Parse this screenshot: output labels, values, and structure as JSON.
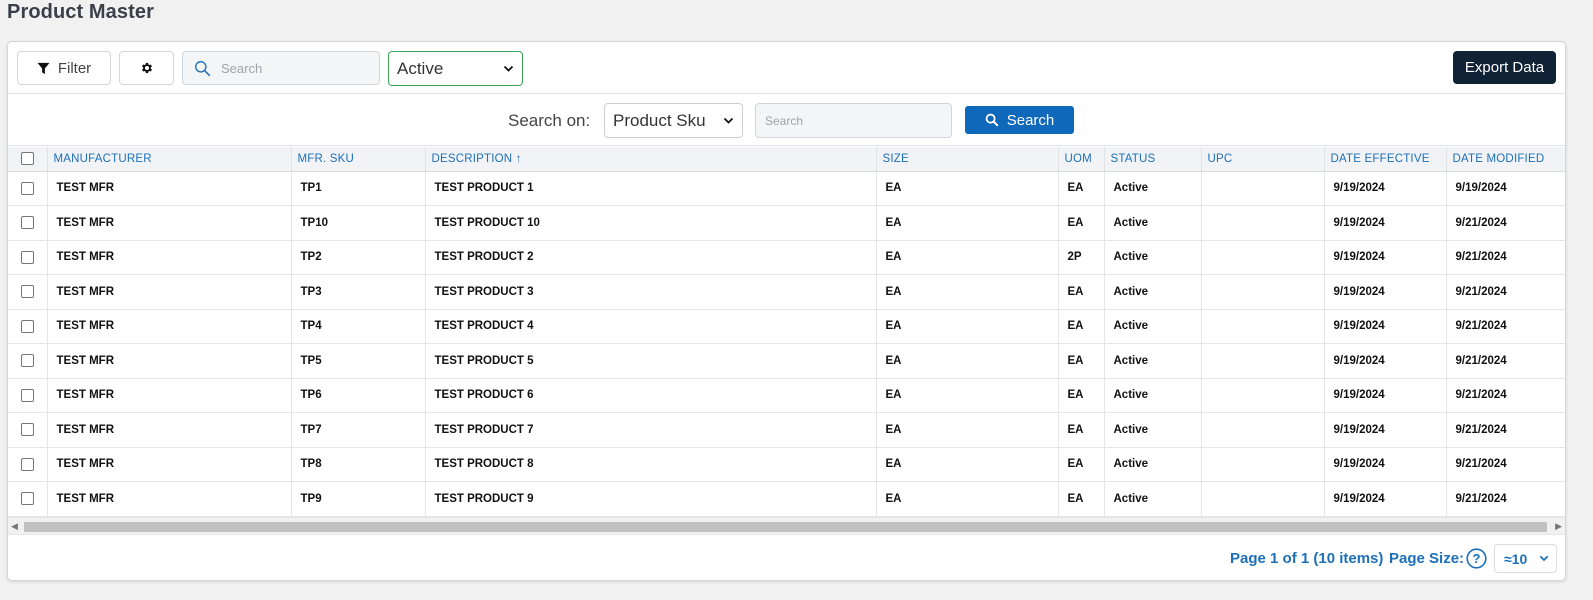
{
  "page": {
    "title": "Product Master"
  },
  "toolbar": {
    "filter_label": "Filter",
    "search_placeholder": "Search",
    "status_value": "Active",
    "export_label": "Export Data"
  },
  "search_row": {
    "label": "Search on:",
    "field_value": "Product Sku",
    "input_placeholder": "Search",
    "button_label": "Search"
  },
  "table": {
    "columns": [
      "MANUFACTURER",
      "MFR. SKU",
      "DESCRIPTION ↑",
      "SIZE",
      "UOM",
      "STATUS",
      "UPC",
      "DATE EFFECTIVE",
      "DATE MODIFIED"
    ],
    "rows": [
      {
        "manufacturer": "TEST MFR",
        "sku": "TP1",
        "description": "TEST PRODUCT 1",
        "size": "EA",
        "uom": "EA",
        "status": "Active",
        "upc": "",
        "date_effective": "9/19/2024",
        "date_modified": "9/19/2024"
      },
      {
        "manufacturer": "TEST MFR",
        "sku": "TP10",
        "description": "TEST PRODUCT 10",
        "size": "EA",
        "uom": "EA",
        "status": "Active",
        "upc": "",
        "date_effective": "9/19/2024",
        "date_modified": "9/21/2024"
      },
      {
        "manufacturer": "TEST MFR",
        "sku": "TP2",
        "description": "TEST PRODUCT 2",
        "size": "EA",
        "uom": "2P",
        "status": "Active",
        "upc": "",
        "date_effective": "9/19/2024",
        "date_modified": "9/21/2024"
      },
      {
        "manufacturer": "TEST MFR",
        "sku": "TP3",
        "description": "TEST PRODUCT 3",
        "size": "EA",
        "uom": "EA",
        "status": "Active",
        "upc": "",
        "date_effective": "9/19/2024",
        "date_modified": "9/21/2024"
      },
      {
        "manufacturer": "TEST MFR",
        "sku": "TP4",
        "description": "TEST PRODUCT 4",
        "size": "EA",
        "uom": "EA",
        "status": "Active",
        "upc": "",
        "date_effective": "9/19/2024",
        "date_modified": "9/21/2024"
      },
      {
        "manufacturer": "TEST MFR",
        "sku": "TP5",
        "description": "TEST PRODUCT 5",
        "size": "EA",
        "uom": "EA",
        "status": "Active",
        "upc": "",
        "date_effective": "9/19/2024",
        "date_modified": "9/21/2024"
      },
      {
        "manufacturer": "TEST MFR",
        "sku": "TP6",
        "description": "TEST PRODUCT 6",
        "size": "EA",
        "uom": "EA",
        "status": "Active",
        "upc": "",
        "date_effective": "9/19/2024",
        "date_modified": "9/21/2024"
      },
      {
        "manufacturer": "TEST MFR",
        "sku": "TP7",
        "description": "TEST PRODUCT 7",
        "size": "EA",
        "uom": "EA",
        "status": "Active",
        "upc": "",
        "date_effective": "9/19/2024",
        "date_modified": "9/21/2024"
      },
      {
        "manufacturer": "TEST MFR",
        "sku": "TP8",
        "description": "TEST PRODUCT 8",
        "size": "EA",
        "uom": "EA",
        "status": "Active",
        "upc": "",
        "date_effective": "9/19/2024",
        "date_modified": "9/21/2024"
      },
      {
        "manufacturer": "TEST MFR",
        "sku": "TP9",
        "description": "TEST PRODUCT 9",
        "size": "EA",
        "uom": "EA",
        "status": "Active",
        "upc": "",
        "date_effective": "9/19/2024",
        "date_modified": "9/21/2024"
      }
    ]
  },
  "pager": {
    "info": "Page 1 of 1 (10 items)",
    "size_label": "Page Size:",
    "size_value": "≈10"
  },
  "colors": {
    "accent": "#1d70b8",
    "primary_button": "#0f68ba",
    "export_button": "#102236",
    "active_border": "#3fa45b"
  },
  "icons": {
    "filter": "filter-icon",
    "settings": "gear-icon",
    "search": "search-icon",
    "dropdown": "chevron-down-icon",
    "help": "help-circle-icon"
  }
}
